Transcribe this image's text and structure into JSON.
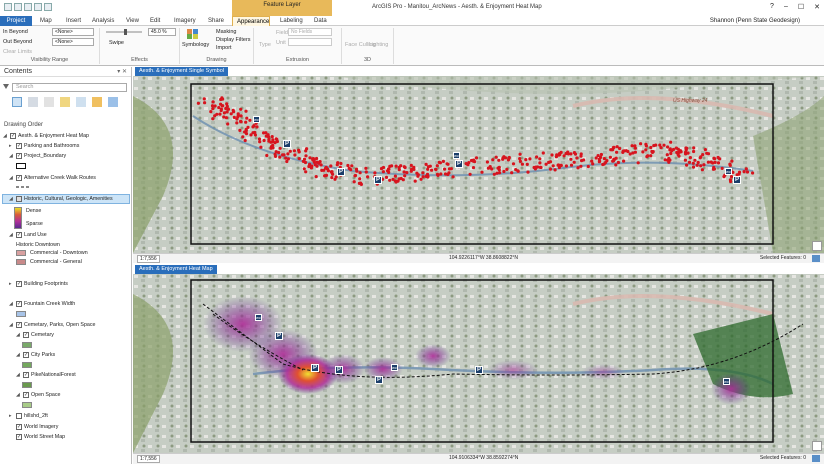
{
  "window": {
    "title": "ArcGIS Pro - Manitou_ArcNews - Aesth. & Enjoyment Heat Map",
    "contextual_group": "Feature Layer"
  },
  "ribbon_tabs": [
    "Project",
    "Map",
    "Insert",
    "Analysis",
    "View",
    "Edit",
    "Imagery",
    "Share",
    "Appearance",
    "Labeling",
    "Data"
  ],
  "active_tab": "Appearance",
  "user": "Shannon (Penn State Geodesign)",
  "ribbon": {
    "visibility_range": {
      "in_beyond": "In Beyond",
      "out_beyond": "Out Beyond",
      "clear_limits": "Clear Limits",
      "in_value": "<None>",
      "out_value": "<None>",
      "group": "Visibility Range"
    },
    "effects": {
      "transparency": "45.0 %",
      "swipe": "Swipe",
      "group": "Effects"
    },
    "drawing": {
      "symbology": "Symbology",
      "masking": "Masking",
      "display_filters": "Display Filters",
      "import": "Import",
      "group": "Drawing"
    },
    "extrusion": {
      "type": "Type",
      "field": "Field",
      "field_value": "No Fields",
      "unit": "Unit",
      "group": "Extrusion"
    },
    "3d": {
      "face_culling": "Face Culling",
      "lighting": "Lighting",
      "group": "3D"
    }
  },
  "contents": {
    "title": "Contents",
    "search_placeholder": "Search",
    "drawing_order": "Drawing Order",
    "layers": [
      {
        "label": "Aesth. & Enjoyment Heat Map"
      },
      {
        "label": "Parking and Bathrooms"
      },
      {
        "label": "Project_Boundary"
      },
      {
        "label": "Alternative Creek Walk Routes"
      },
      {
        "label": "Historic, Cultural, Geologic, Amenities"
      },
      {
        "label": "Dense"
      },
      {
        "label": "Sparse"
      },
      {
        "label": "Land Use"
      },
      {
        "label": "Historic Downtown"
      },
      {
        "label": "Commercial - Downtown"
      },
      {
        "label": "Commercial - General"
      },
      {
        "label": "Building Footprints"
      },
      {
        "label": "Fountain Creek Width"
      },
      {
        "label": "Cemetary, Parks, Open Space"
      },
      {
        "label": "Cemetary"
      },
      {
        "label": "City Parks"
      },
      {
        "label": "PikeNationalForest"
      },
      {
        "label": "Open Space"
      },
      {
        "label": "hillshd_2ft"
      },
      {
        "label": "World Imagery"
      },
      {
        "label": "World Street Map"
      }
    ]
  },
  "maps": [
    {
      "tab": "Aesth. & Enjoyment Single Symbol",
      "scale": "1:7,556",
      "coords": "104.9226117°W 38.8608822°N",
      "selected": "Selected Features: 0",
      "road_label": "US Highway 24"
    },
    {
      "tab": "Aesth. & Enjoyment Heat Map",
      "scale": "1:7,556",
      "coords": "104.9106334°W 38.8592274°N",
      "selected": "Selected Features: 0"
    }
  ],
  "colors": {
    "accent": "#2a6ebb",
    "contextual": "#e8b95a",
    "dot": "#d7141e",
    "heat_high": "#e8e028",
    "heat_low": "#5a2a90"
  }
}
